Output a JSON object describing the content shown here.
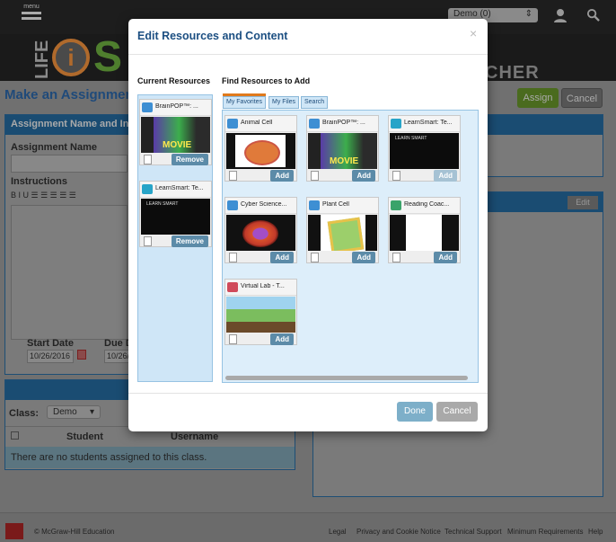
{
  "topbar": {
    "menu_label": "menu",
    "user_select": "Demo (0)"
  },
  "banner": {
    "life": "LIFE",
    "logo_i": "i",
    "logo_s": "S",
    "center_text": "CHER CENTER"
  },
  "page": {
    "title": "Make an Assignment",
    "assign_label": "Assign",
    "cancel_label": "Cancel",
    "panel_name_header": "Assignment Name and Instru",
    "assignment_name_label": "Assignment Name",
    "instructions_label": "Instructions",
    "editor_tools": "B  I  U   ☰  ☰   ☰  ☰  ☰",
    "start_date_label": "Start Date",
    "start_date_value": "10/26/2016",
    "due_date_label": "Due D",
    "due_date_value": "10/26/",
    "edit_label": "Edit",
    "class_label": "Class:",
    "class_value": "Demo",
    "student_col": "Student",
    "username_col": "Username",
    "no_students": "There are no students assigned to this class."
  },
  "footer": {
    "logo_text": "Mc Graw Hill Education",
    "copyright": "© McGraw-Hill Education",
    "links": [
      "Legal",
      "Privacy and Cookie Notice",
      "Technical Support",
      "Minimum Requirements",
      "Help"
    ]
  },
  "modal": {
    "title": "Edit Resources and Content",
    "close": "×",
    "current_title": "Current Resources",
    "find_title": "Find Resources to Add",
    "tabs": [
      "My Favorites",
      "My Files",
      "Search"
    ],
    "done_label": "Done",
    "cancel_label": "Cancel",
    "current": [
      {
        "title": "BrainPOP™: ...",
        "action": "Remove",
        "icon": "video-icon"
      },
      {
        "title": "LearnSmart: Te...",
        "action": "Remove",
        "icon": "learnsmart-icon"
      }
    ],
    "find": [
      {
        "title": "Animal Cell",
        "action": "Add",
        "icon": "video-icon"
      },
      {
        "title": "BrainPOP™: ...",
        "action": "Add",
        "icon": "video-icon"
      },
      {
        "title": "LearnSmart: Te...",
        "action": "Add",
        "icon": "learnsmart-icon",
        "disabled": true
      },
      {
        "title": "Cyber Science...",
        "action": "Add",
        "icon": "video-icon"
      },
      {
        "title": "Plant Cell",
        "action": "Add",
        "icon": "video-icon"
      },
      {
        "title": "Reading Coac...",
        "action": "Add",
        "icon": "document-icon"
      },
      {
        "title": "Virtual Lab - T...",
        "action": "Add",
        "icon": "virtual-lab-icon"
      }
    ]
  },
  "thumbs": {
    "learnsmart": "LEARN SMART"
  }
}
